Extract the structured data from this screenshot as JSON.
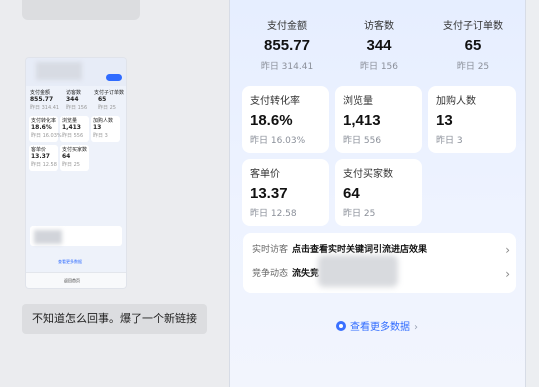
{
  "chat": {
    "message": "不知道怎么回事。爆了一个新链接",
    "thumbnail": {
      "kpis": [
        {
          "label": "支付金额",
          "value": "855.77",
          "prev": "昨日 314.41"
        },
        {
          "label": "访客数",
          "value": "344",
          "prev": "昨日 156"
        },
        {
          "label": "支付子订单数",
          "value": "65",
          "prev": "昨日 25"
        }
      ],
      "cards": [
        {
          "label": "支付转化率",
          "value": "18.6%",
          "prev": "昨日 16.03%"
        },
        {
          "label": "浏览量",
          "value": "1,413",
          "prev": "昨日 556"
        },
        {
          "label": "加购人数",
          "value": "13",
          "prev": "昨日 3"
        },
        {
          "label": "客单价",
          "value": "13.37",
          "prev": "昨日 12.58"
        },
        {
          "label": "支付买家数",
          "value": "64",
          "prev": "昨日 25"
        }
      ],
      "more_link": "查看更多数据",
      "footer_label": "返回首页"
    }
  },
  "dashboard": {
    "kpis": [
      {
        "label": "支付金额",
        "value": "855.77",
        "prev": "昨日 314.41"
      },
      {
        "label": "访客数",
        "value": "344",
        "prev": "昨日 156"
      },
      {
        "label": "支付子订单数",
        "value": "65",
        "prev": "昨日 25"
      }
    ],
    "cards": [
      {
        "label": "支付转化率",
        "value": "18.6%",
        "prev": "昨日 16.03%"
      },
      {
        "label": "浏览量",
        "value": "1,413",
        "prev": "昨日 556"
      },
      {
        "label": "加购人数",
        "value": "13",
        "prev": "昨日 3"
      },
      {
        "label": "客单价",
        "value": "13.37",
        "prev": "昨日 12.58"
      },
      {
        "label": "支付买家数",
        "value": "64",
        "prev": "昨日 25"
      }
    ],
    "info": {
      "realtime_key": "实时访客",
      "realtime_value": "点击查看实时关键词引流进店效果",
      "competition_key": "竞争动态",
      "competition_value": "流失竞"
    },
    "more_link": "查看更多数据",
    "colors": {
      "accent": "#2f6bff",
      "panel_bg": "#e6eeff",
      "card_bg": "#ffffff"
    },
    "icons": {
      "chevron": "chevron-right-icon",
      "more": "data-circle-icon"
    }
  }
}
